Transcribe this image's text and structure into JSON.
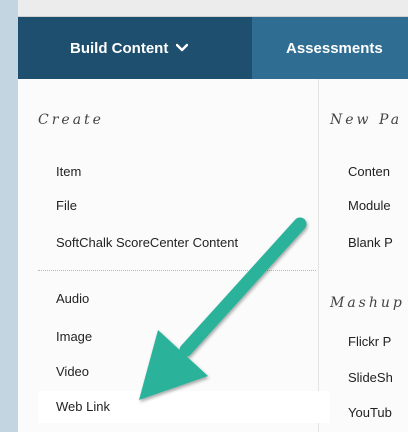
{
  "tabs": [
    {
      "label": "Build Content"
    },
    {
      "label": "Assessments"
    }
  ],
  "icons": {
    "chevron": "chevron-down-icon",
    "arrow": "teal-arrow-annotation"
  },
  "colors": {
    "tabbar": "#2f6d93",
    "active_tab": "#1e4f6e",
    "arrow": "#2bb39a"
  },
  "create": {
    "heading": "Create",
    "items": [
      "Item",
      "File",
      "SoftChalk ScoreCenter Content",
      "Audio",
      "Image",
      "Video",
      "Web Link"
    ]
  },
  "new_page": {
    "heading": "New Pa",
    "items": [
      "Conten",
      "Module",
      "Blank P"
    ]
  },
  "mashups": {
    "heading": "Mashup",
    "items": [
      "Flickr P",
      "SlideSh",
      "YouTub"
    ]
  }
}
